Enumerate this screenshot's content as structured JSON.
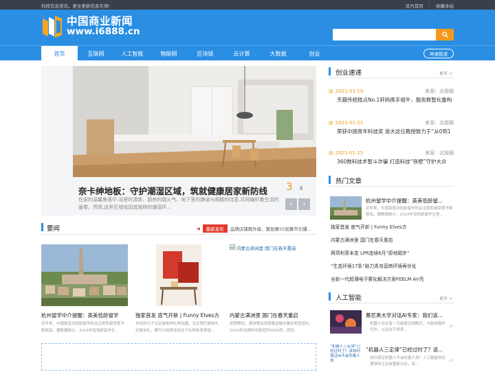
{
  "topbar": {
    "left": "科技信息资讯，更全更新信息实用!",
    "set_home": "设为首页",
    "sep": "|",
    "bookmark": "收藏本站"
  },
  "logo": {
    "cn": "中国商业新闻",
    "url": "www.i6888.cn"
  },
  "search": {
    "placeholder": "",
    "icon": "search-icon"
  },
  "nav": {
    "items": [
      "首页",
      "互联网",
      "人工智能",
      "物联网",
      "区块链",
      "云计算",
      "大数据",
      "创业"
    ],
    "submit": "申请投递"
  },
  "slider": {
    "title": "奈卡绅地板：守护潮湿区域，筑就健康居家新防线",
    "current": "3",
    "total": "4",
    "desc": "在家的温馨角落中,浴室的清新、厨房的烟火气、地下室的静谧与阁楼的诗意,共同编织着生活的画卷。然而,这些区域也因其独特的潮湿环..."
  },
  "yaowen": {
    "title": "要闻",
    "tag": "最新发布",
    "ticker": "品牌店铺再升级，聚划算55划算节引爆..."
  },
  "cards": [
    {
      "title": "杭州留学中介提醒：英美低龄留学",
      "desc": "近年来，中国家庭对低龄留学的关注度和接受度不断提高。据数据统计，2014年有低龄留学生..."
    },
    {
      "title": "独家首发 底气开新 | Funny Elves方",
      "desc": "年初的日子注定被各种礼物包围。无论我们是收礼还是送礼，都可以收获这份关于礼物本身带给..."
    },
    {
      "title": "内蒙古满洲里 国门在春天重启",
      "broken_alt": "内蒙古满洲里 国门在春天重启",
      "desc": "疫情期间，满洲里出境铁路运输总量有明显增长。2019年出境的中欧班列3000列，西安..."
    }
  ],
  "chuangye": {
    "title": "创业速递",
    "more": "更多 >",
    "items": [
      {
        "date": "2021-03-19",
        "src": "来源：北极圈",
        "text": "天猫传统糕点No.1轩妈携手祖牛，服务数智化重构"
      },
      {
        "date": "2021-01-25",
        "src": "来源：北极圈",
        "text": "荣获中国青年科技奖 浙大这位教授致力于“从0到1"
      },
      {
        "date": "2021-01-25",
        "src": "来源：北极圈",
        "text": "360数科技术智斗诈骗 打造科技“铁壁”守护大众"
      }
    ]
  },
  "hot": {
    "title": "热门文章",
    "feature_title": "杭州留学中介提醒：英美低龄留...",
    "feature_desc": "近年来，中国家庭对低龄留学的关注度和接受度不断提高。据数据统计，2014年有低龄留学生意...",
    "list": [
      "独家首发 底气开新 | Funny Elves方",
      "内蒙古满洲里 国门在春天重启",
      "两项利率未变 LPR连续6月“原地踏步”",
      "“生态环境17条”助力青岛营商环境再优化",
      "全新一代超薄电子雾化解决方案FEELM Air亮"
    ]
  },
  "ai": {
    "title": "人工智能",
    "more": "更多 >",
    "items": [
      {
        "title": "慕尼黑大学对话AI专家：我们该...",
        "desc": "机器人也许有一天能够互相聊天，与新闻稿件写作，以及对于将来..."
      },
      {
        "title": "“机器人三定律”已经过时了？该...",
        "alt": "“机器人三定律”已经过时了？该如何保证AI不会伤害人类",
        "desc": "如何保证机器人不会伤害人类？人工智能的伦理准则正在被重新讨论，该..."
      }
    ]
  },
  "colors": {
    "brand": "#2a8ee3",
    "accent": "#f39a1e",
    "tag": "#e33b2e"
  }
}
